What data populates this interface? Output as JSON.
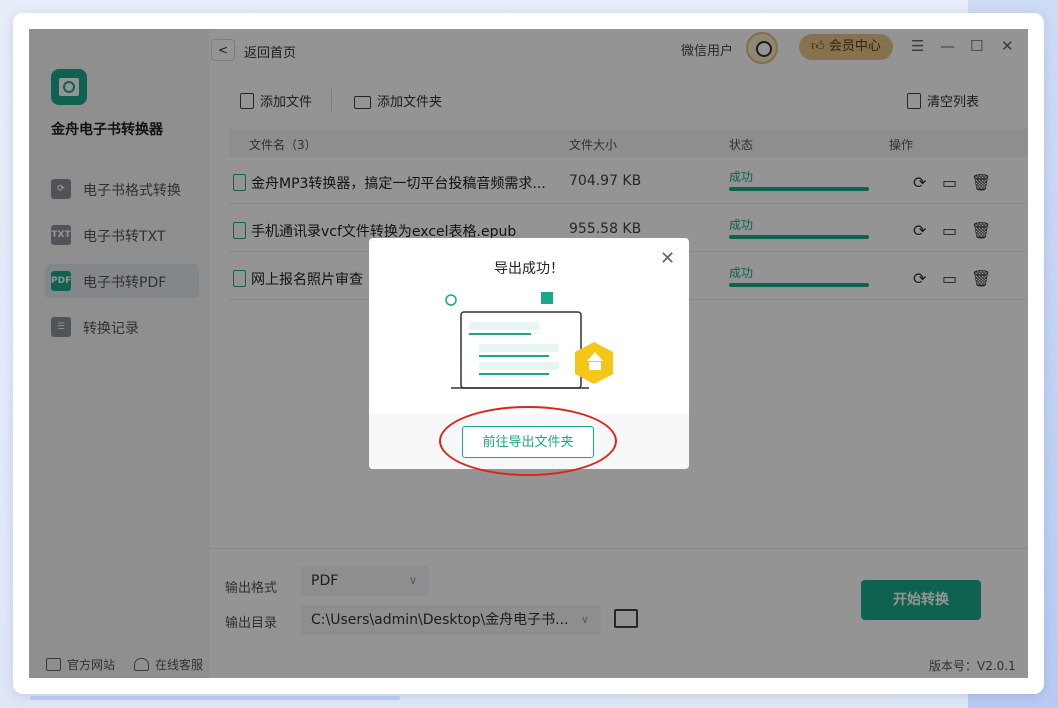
{
  "app": {
    "name": "金舟电子书转换器",
    "version": "版本号：V2.0.1"
  },
  "sidebar": {
    "items": [
      {
        "icon": "refresh-book-icon",
        "label": "电子书格式转换",
        "badge": ""
      },
      {
        "icon": "txt-icon",
        "label": "电子书转TXT",
        "badge": "TXT"
      },
      {
        "icon": "pdf-icon",
        "label": "电子书转PDF",
        "badge": "PDF"
      },
      {
        "icon": "list-icon",
        "label": "转换记录",
        "badge": ""
      }
    ],
    "footer": {
      "website": "官方网站",
      "support": "在线客服"
    }
  },
  "header": {
    "back_label": "返回首页",
    "user_label": "微信用户",
    "vip_label": "会员中心",
    "vip_icon": "thumb-up-icon"
  },
  "toolbar": {
    "add_file": "添加文件",
    "add_folder": "添加文件夹",
    "clear_list": "清空列表"
  },
  "table": {
    "headers": {
      "name": "文件名（3）",
      "size": "文件大小",
      "status": "状态",
      "action": "操作"
    },
    "rows": [
      {
        "name": "金舟MP3转换器，搞定一切平台投稿音频需求...",
        "size": "704.97 KB",
        "status": "成功",
        "progress": 1.0
      },
      {
        "name": "手机通讯录vcf文件转换为excel表格.epub",
        "size": "955.58 KB",
        "status": "成功",
        "progress": 1.0
      },
      {
        "name": "网上报名照片审查",
        "size": "",
        "status": "成功",
        "progress": 1.0
      }
    ]
  },
  "output": {
    "format_label": "输出格式",
    "format_value": "PDF",
    "dir_label": "输出目录",
    "dir_value": "C:\\Users\\admin\\Desktop\\金舟电子书...",
    "start_label": "开始转换"
  },
  "dialog": {
    "title": "导出成功！",
    "button": "前往导出文件夹"
  },
  "colors": {
    "accent": "#1aa88a",
    "vip": "#e9c489",
    "highlight_ring": "#d9261c"
  }
}
